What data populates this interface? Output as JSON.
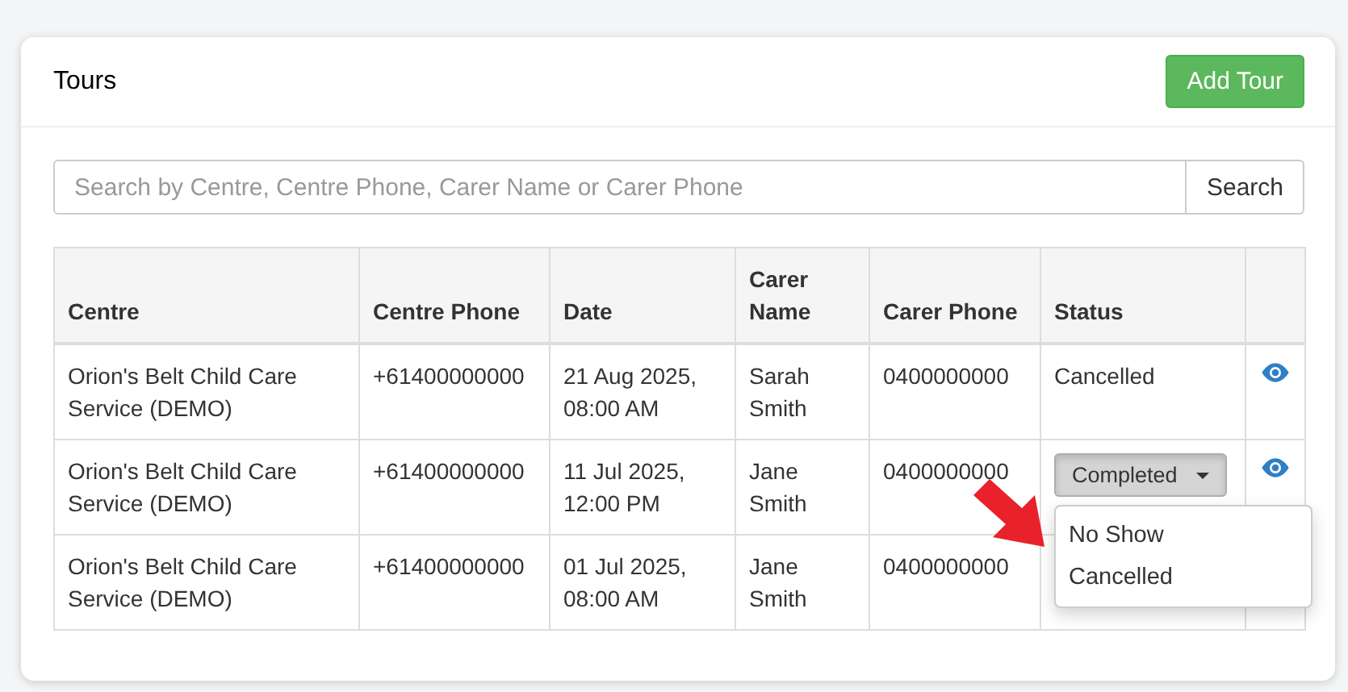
{
  "card": {
    "title": "Tours",
    "add_button": "Add Tour"
  },
  "search": {
    "placeholder": "Search by Centre, Centre Phone, Carer Name or Carer Phone",
    "button": "Search"
  },
  "table": {
    "columns": [
      "Centre",
      "Centre Phone",
      "Date",
      "Carer Name",
      "Carer Phone",
      "Status"
    ],
    "rows": [
      {
        "centre": "Orion's Belt Child Care Service (DEMO)",
        "centre_phone": "+61400000000",
        "date": "21 Aug 2025, 08:00 AM",
        "carer_name": "Sarah Smith",
        "carer_phone": "0400000000",
        "status": {
          "kind": "text",
          "value": "Cancelled"
        },
        "view": true
      },
      {
        "centre": "Orion's Belt Child Care Service (DEMO)",
        "centre_phone": "+61400000000",
        "date": "11 Jul 2025, 12:00 PM",
        "carer_name": "Jane Smith",
        "carer_phone": "0400000000",
        "status": {
          "kind": "select",
          "value": "Completed",
          "expanded": true,
          "options": [
            {
              "label": "No Show",
              "selected": false
            },
            {
              "label": "Cancelled",
              "selected": false
            }
          ]
        },
        "view": true
      },
      {
        "centre": "Orion's Belt Child Care Service (DEMO)",
        "centre_phone": "+61400000000",
        "date": "01 Jul 2025, 08:00 AM",
        "carer_name": "Jane Smith",
        "carer_phone": "0400000000"
      }
    ]
  }
}
